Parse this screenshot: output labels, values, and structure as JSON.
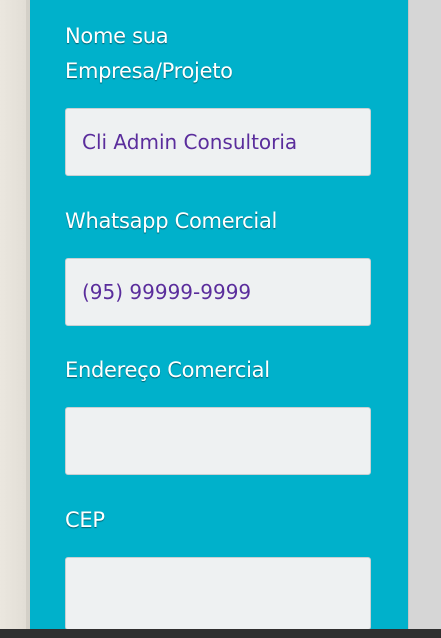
{
  "form": {
    "company": {
      "label": "Nome sua Empresa/Projeto",
      "value": "Cli Admin Consultoria"
    },
    "whatsapp": {
      "label": "Whatsapp Comercial",
      "value": "(95) 99999-9999"
    },
    "address": {
      "label": "Endereço Comercial",
      "value": ""
    },
    "cep": {
      "label": "CEP",
      "value": ""
    }
  },
  "colors": {
    "panel": "#00b1cb",
    "field_bg": "#eef1f2",
    "field_text": "#5a2d9c",
    "label_text": "#ffffff"
  }
}
